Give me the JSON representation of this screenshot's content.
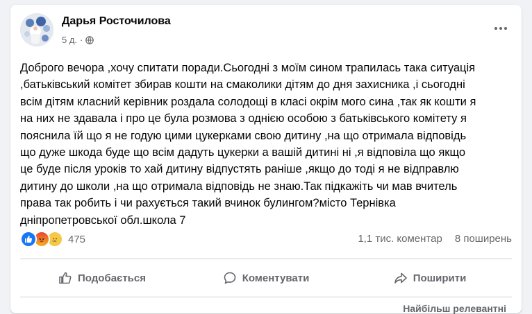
{
  "post": {
    "author": "Дарья Росточилова",
    "time": "5 д.",
    "separator": "·",
    "text_lines": [
      "Доброго вечора ,хочу спитати поради.Сьогодні з моїм сином трапилась така ситуація",
      ",батьківський комітет збирав кошти на смаколики дітям до дня захисника ,і сьогодні",
      "всім дітям класний керівник роздала солодощі в класі окрім мого сина ,так як кошти я",
      "на них не здавала і про це була розмова з однією особою з батьківського комітету я",
      "пояснила їй що я не годую цими цукерками свою дитину ,на що отримала відповідь",
      "що дуже шкода буде що всім дадуть цукерки а вашій дитині ні ,я відповіла що якщо",
      "це буде після уроків то хай дитину відпустять раніше ,якщо до тоді я не відправлю",
      "дитину до школи ,на що отримала відповідь не знаю.Так підкажіть чи мав вчитель",
      "права так робить і чи рахується такий вчинок булингом?місто Тернівка",
      "дніпропетровської обл.школа 7"
    ]
  },
  "reactions": {
    "types": [
      "like",
      "angry",
      "sad"
    ],
    "count": "475"
  },
  "stats": {
    "comments": "1,1 тис. коментар",
    "shares": "8 поширень"
  },
  "actions": {
    "like_label": "Подобається",
    "comment_label": "Коментувати",
    "share_label": "Поширити"
  },
  "sort_label": "Найбільш релевантні"
}
